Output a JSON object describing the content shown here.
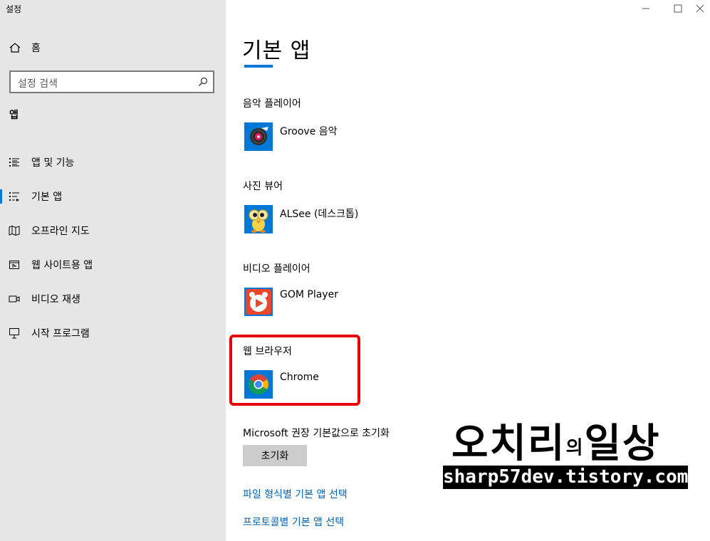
{
  "window": {
    "title": "설정",
    "controls": [
      "minimize-icon",
      "maximize-icon",
      "close-icon"
    ]
  },
  "sidebar": {
    "home_label": "홈",
    "search_placeholder": "설정 검색",
    "section_label": "앱",
    "items": [
      {
        "label": "앱 및 기능",
        "icon": "apps-features-icon",
        "selected": false
      },
      {
        "label": "기본 앱",
        "icon": "default-apps-icon",
        "selected": true
      },
      {
        "label": "오프라인 지도",
        "icon": "offline-maps-icon",
        "selected": false
      },
      {
        "label": "웹 사이트용 앱",
        "icon": "apps-for-websites-icon",
        "selected": false
      },
      {
        "label": "비디오 재생",
        "icon": "video-playback-icon",
        "selected": false
      },
      {
        "label": "시작 프로그램",
        "icon": "startup-icon",
        "selected": false
      }
    ]
  },
  "main": {
    "title": "기본 앱",
    "categories": [
      {
        "label": "음악 플레이어",
        "app": "Groove 음악",
        "icon": "groove-music-icon"
      },
      {
        "label": "사진 뷰어",
        "app": "ALSee (데스크톱)",
        "icon": "alsee-icon"
      },
      {
        "label": "비디오 플레이어",
        "app": "GOM Player",
        "icon": "gom-player-icon"
      },
      {
        "label": "웹 브라우저",
        "app": "Chrome",
        "icon": "chrome-icon"
      }
    ],
    "reset_label": "Microsoft 권장 기본값으로 초기화",
    "reset_button": "초기화",
    "links": [
      "파일 형식별 기본 앱 선택",
      "프로토콜별 기본 앱 선택"
    ]
  },
  "watermark": {
    "title_main": "오치리",
    "title_small": "의",
    "title_end": "일상",
    "url": "sharp57dev.tistory.com"
  },
  "colors": {
    "accent": "#0078d7",
    "highlight": "#e60000",
    "link": "#0063b1",
    "sidebar_bg": "#e6e6e6"
  }
}
